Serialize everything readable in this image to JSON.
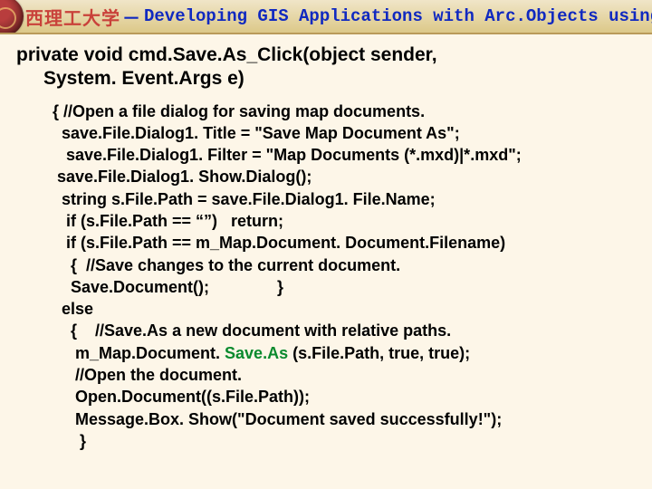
{
  "header": {
    "cn": "西理工大学",
    "dash": "－",
    "en": "Developing GIS Applications with Arc.Objects using C#. NE"
  },
  "signature": {
    "line1": "private void cmd.Save.As_Click(object sender,",
    "line2": "System. Event.Args e)"
  },
  "code": {
    "l01": "{ //Open a file dialog for saving map documents.",
    "l02": "  save.File.Dialog1. Title = \"Save Map Document As\";",
    "l03": "   save.File.Dialog1. Filter = \"Map Documents (*.mxd)|*.mxd\";",
    "l04": " save.File.Dialog1. Show.Dialog();",
    "l05": "  string s.File.Path = save.File.Dialog1. File.Name;",
    "l06": "   if (s.File.Path == “”)   return;",
    "l07": "   if (s.File.Path == m_Map.Document. Document.Filename)",
    "l08": "    {  //Save changes to the current document.",
    "l09": "    Save.Document();               }",
    "l10": "  else",
    "l11": "    {    //Save.As a new document with relative paths.",
    "l12a": "     m_Map.Document. ",
    "l12b": "Save.As ",
    "l12c": "(s.File.Path, true, true);",
    "l13": "     //Open the document.",
    "l14": "     Open.Document((s.File.Path));",
    "l15": "     Message.Box. Show(\"Document saved successfully!\");",
    "l16": "      }"
  }
}
